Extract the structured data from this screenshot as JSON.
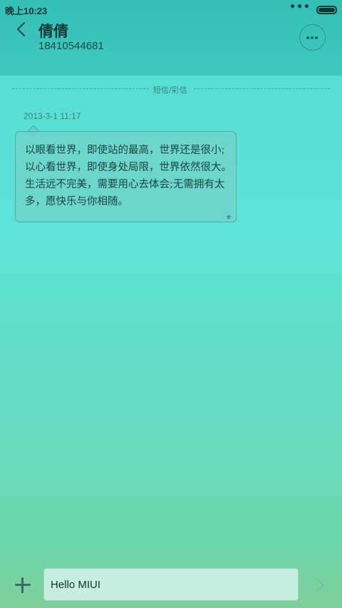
{
  "status_bar": {
    "time": "晚上10:23",
    "signal_dots": "•••",
    "battery_level": 1.0
  },
  "header": {
    "contact_name": "倩倩",
    "phone_number": "18410544681",
    "back_icon": "chevron-left-icon",
    "more_icon": "more-dots-icon"
  },
  "thread": {
    "type_label": "短信/彩信",
    "messages": [
      {
        "timestamp": "2013-3-1 11:17",
        "text": "以眼看世界，即使站的最高，世界还是很小;以心看世界，即使身处局限，世界依然很大。生活远不完美，需要用心去体会;无需拥有太多，愿快乐与你相随。",
        "starred": true
      }
    ]
  },
  "composer": {
    "value": "Hello MIUI",
    "add_icon": "plus-icon",
    "send_icon": "chevron-right-icon"
  },
  "colors": {
    "header": "#3fcabf",
    "background_top": "#5fe2d6",
    "background_bottom": "#7fcf98",
    "input": "#c6ede0"
  }
}
